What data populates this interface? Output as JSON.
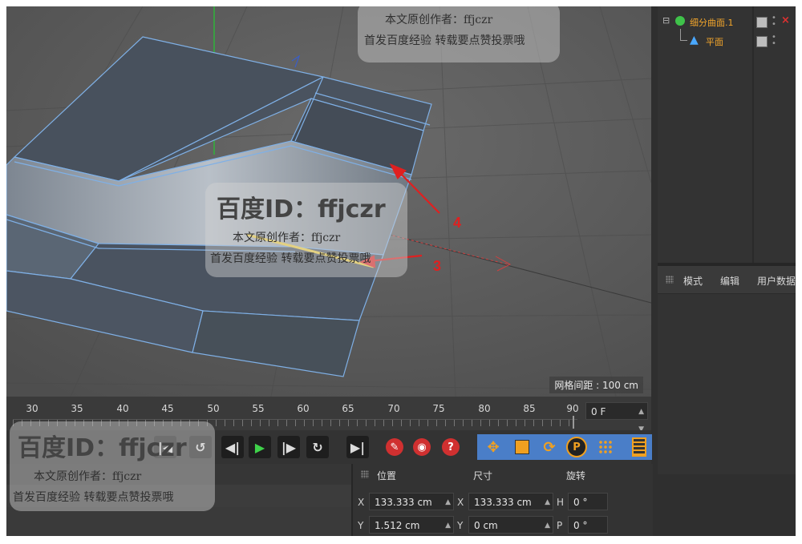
{
  "object_manager": {
    "items": [
      {
        "label": "细分曲面.1",
        "color": "#f2a52b"
      },
      {
        "label": "平面",
        "color": "#f2a52b"
      }
    ]
  },
  "attribute_manager": {
    "tabs": [
      "模式",
      "编辑",
      "用户数据"
    ]
  },
  "viewport": {
    "grid_spacing": "网格间距 : 100 cm",
    "annotations": [
      "4",
      "3"
    ],
    "annotation_color": "#e02020"
  },
  "timeline": {
    "ticks": [
      "30",
      "35",
      "40",
      "45",
      "50",
      "55",
      "60",
      "65",
      "70",
      "75",
      "80",
      "85",
      "90"
    ],
    "current_frame": "0 F"
  },
  "coordinates": {
    "headers": {
      "position": "位置",
      "size": "尺寸",
      "rotation": "旋转"
    },
    "rows": [
      {
        "axis": "X",
        "position": "133.333 cm",
        "size_axis": "X",
        "size": "133.333 cm",
        "rot_axis": "H",
        "rotation": "0 °"
      },
      {
        "axis": "Y",
        "position": "1.512 cm",
        "size_axis": "Y",
        "size": "0 cm",
        "rot_axis": "P",
        "rotation": "0 °"
      }
    ]
  },
  "watermark": {
    "id_line": "百度ID：ffjczr",
    "author_line": "本文原创作者：ffjczr",
    "promo_line": "首发百度经验 转载要点赞投票哦"
  },
  "colors": {
    "accent_blue": "#4a7ec8",
    "selection_yellow": "#f0d040",
    "mesh_edge": "#7fb0e6"
  }
}
